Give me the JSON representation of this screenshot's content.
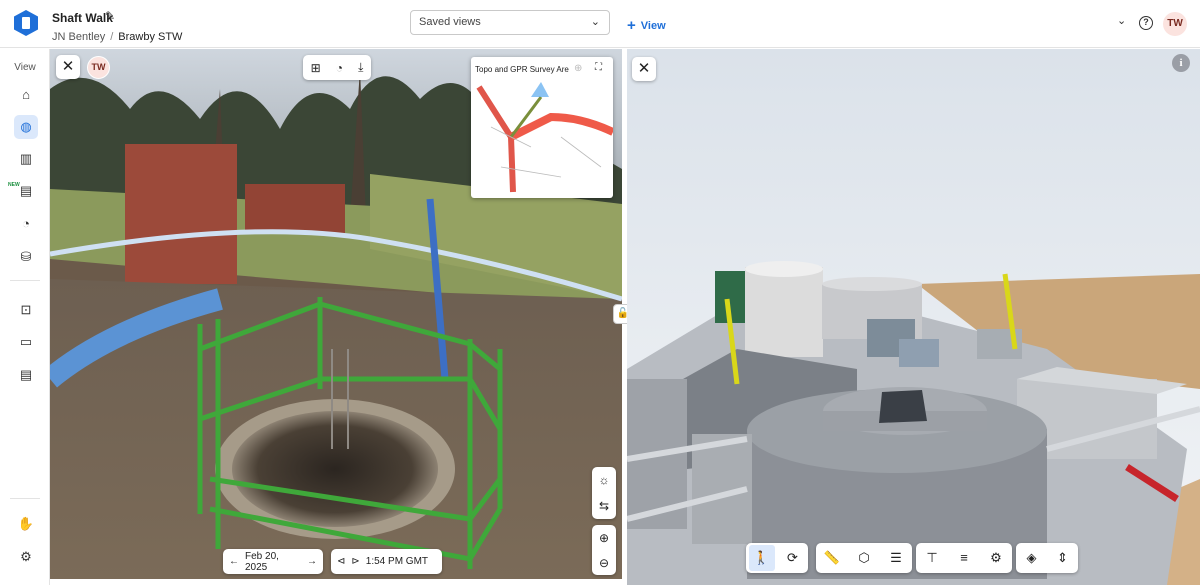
{
  "header": {
    "project_title": "Shaft Walk",
    "breadcrumb": [
      "JN Bentley",
      "Brawby STW"
    ],
    "saved_views_placeholder": "Saved views",
    "add_view_label": "View",
    "user_initials": "TW"
  },
  "rail": {
    "label": "View",
    "new_badge": "NEW",
    "icons": [
      "home-icon",
      "globe-icon",
      "map-icon",
      "report-icon",
      "timeline-icon",
      "bim-icon",
      "capture-icon",
      "folder-icon",
      "document-icon",
      "support-icon",
      "settings-icon"
    ],
    "active": "globe-icon"
  },
  "pano": {
    "user_initials": "TW",
    "minimap_title": "Topo and GPR Survey Area",
    "date_label": "Feb 20, 2025",
    "time_label": "1:54 PM GMT",
    "tool_icons": [
      "add-note-icon",
      "add-photo-icon",
      "download-icon"
    ],
    "side_tool_icons": [
      "brightness-icon",
      "adjust-icon",
      "zoom-in-icon",
      "zoom-out-icon"
    ]
  },
  "model": {
    "toolbar_groups": [
      [
        "person-icon",
        "orbit-icon"
      ],
      [
        "measure-icon",
        "section-box-icon",
        "layers-icon"
      ],
      [
        "hierarchy-icon",
        "stack-icon",
        "gear-icon"
      ],
      [
        "layers-alt-icon",
        "vertical-arrows-icon"
      ]
    ],
    "active_tool": "person-icon"
  },
  "colors": {
    "accent": "#1f6fd8",
    "avatar_bg": "#fbe3df",
    "fence_green": "#3fa83a"
  }
}
